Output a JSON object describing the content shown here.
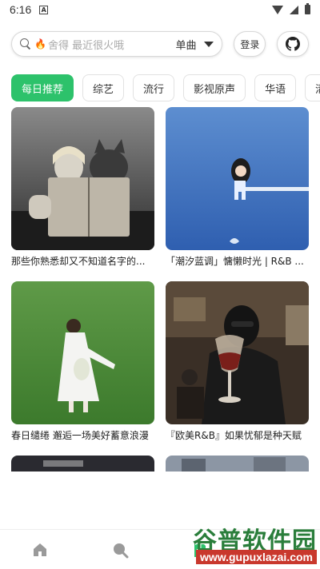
{
  "status_bar": {
    "time": "6:16",
    "notification_glyph": "A"
  },
  "search": {
    "placeholder": "舍得 最近很火哦",
    "type_label": "单曲",
    "login_label": "登录"
  },
  "categories": [
    {
      "label": "每日推荐",
      "active": true
    },
    {
      "label": "综艺",
      "active": false
    },
    {
      "label": "流行",
      "active": false
    },
    {
      "label": "影视原声",
      "active": false
    },
    {
      "label": "华语",
      "active": false
    },
    {
      "label": "清晨",
      "active": false
    }
  ],
  "playlists": [
    {
      "title": "那些你熟悉却又不知道名字的...",
      "cover": "book-girl-cat-bw"
    },
    {
      "title": "「潮汐蓝调」慵懒时光 | R&B ...",
      "cover": "blue-sea-figure"
    },
    {
      "title": "春日缱绻 邂逅一场美好蓄意浪漫",
      "cover": "girl-green-field"
    },
    {
      "title": "『欧美R&B』如果忧郁是种天赋",
      "cover": "woman-wine-glass-studio"
    }
  ],
  "nav": {
    "home_icon": "home-icon",
    "search_icon": "search-icon",
    "library_icon": "document-icon",
    "active_color": "#2dc26b"
  },
  "watermark": {
    "title": "谷普软件园",
    "url": "www.gupuxlazai.com"
  },
  "colors": {
    "accent": "#2dc26b"
  }
}
